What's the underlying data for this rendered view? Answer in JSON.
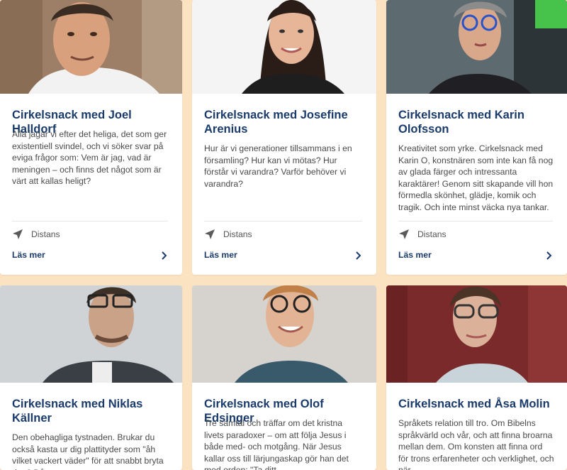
{
  "cards": [
    {
      "title": "Cirkelsnack med Joel Halldorf",
      "description": "Alla jagar vi efter det heliga, det som ger existentiell svindel, och vi söker svar på eviga frågor som: Vem är jag, vad är meningen – och finns det något som är värt att kallas heligt?",
      "location": "Distans",
      "link": "Läs mer"
    },
    {
      "title": "Cirkelsnack med Josefine Arenius",
      "description": "Hur är vi generationer tillsammans i en församling? Hur kan vi mötas? Hur förstår vi varandra? Varför behöver vi varandra?",
      "location": "Distans",
      "link": "Läs mer"
    },
    {
      "title": "Cirkelsnack med Karin Olofsson",
      "description": "Kreativitet som yrke. Cirkelsnack med Karin O, konstnären som inte kan få nog av glada färger och intressanta karaktärer! Genom sitt skapande vill hon förmedla skönhet, glädje, komik och tragik. Och inte minst väcka nya tankar.",
      "location": "Distans",
      "link": "Läs mer"
    },
    {
      "title": "Cirkelsnack med Niklas Källner",
      "description": "Den obehagliga tystnaden. Brukar du också kasta ur dig plattityder som \"åh vilket vackert väder\" för att snabbt bryta den? Då"
    },
    {
      "title": "Cirkelsnack med Olof Edsinger",
      "description": "Tre samtal och träffar om det kristna livets paradoxer – om att följa Jesus i både med- och motgång. När Jesus kallar oss till lärjungaskap gör han det med orden: \"Ta ditt"
    },
    {
      "title": "Cirkelsnack med Åsa Molin",
      "description": "Språkets relation till tro. Om Bibelns språkvärld och vår, och att finna broarna mellan dem. Om konsten att finna ord för trons erfarenheter och verklighet, och när"
    }
  ],
  "colors": {
    "page_background": "#fbe3c2",
    "title": "#1a3b6b",
    "link": "#1a3b6b",
    "body_text": "#4a4a4a"
  },
  "icons": {
    "location": "navigation-arrow-icon",
    "link": "chevron-right-icon"
  }
}
